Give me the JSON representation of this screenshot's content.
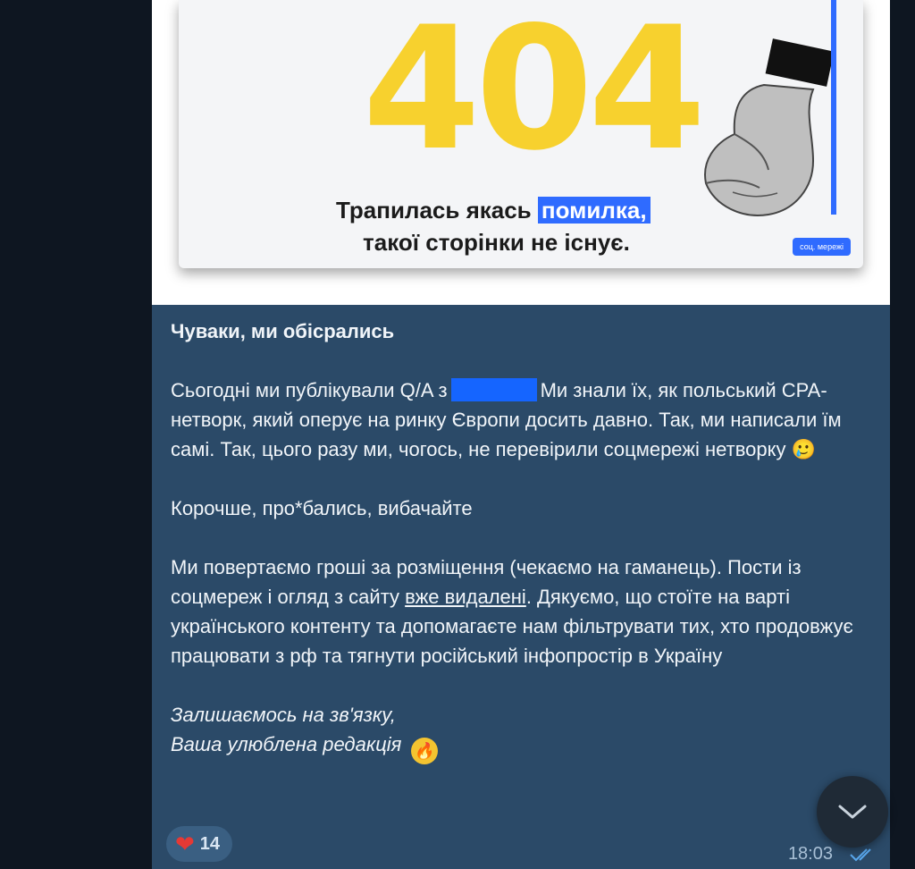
{
  "image_card": {
    "big_text": "404",
    "error_line1_prefix": "Трапилась якась ",
    "error_line1_highlight": "помилка,",
    "error_line2": "такої сторінки не існує.",
    "social_chip": "соц. мережі"
  },
  "message": {
    "title": "Чуваки, ми обісрались",
    "p1_part1": "Сьогодні ми публікували Q/A з",
    "p1_part2": "Ми знали їх, як польський CPA-нетворк, який оперує на ринку Європи досить давно. Так, ми написали їм самі. Так, цього разу ми, чогось, не перевірили соцмережі нетворку",
    "p1_emoji": "🥲",
    "p2": "Корочше, про*бались, вибачайте",
    "p3_part1": "Ми повертаємо гроші за розміщення (чекаємо на гаманець). Пости із соцмереж і огляд з сайту ",
    "p3_link": "вже видалені",
    "p3_part2": ". Дякуємо, що стоїте на варті українського контенту та допомагаєте нам фільтрувати тих, хто продовжує працювати з рф та тягнути російський інфопростір в Україну",
    "sign1": "Залишаємось на зв'язку,",
    "sign2": "Ваша улюблена редакція",
    "sign_emoji": "🔥"
  },
  "reaction": {
    "emoji": "❤",
    "count": "14"
  },
  "meta": {
    "time": "18:03"
  },
  "colors": {
    "bubble": "#2b4a68",
    "background": "#0e1621",
    "accent_blue": "#2f6bff",
    "yellow": "#f7d12e"
  }
}
